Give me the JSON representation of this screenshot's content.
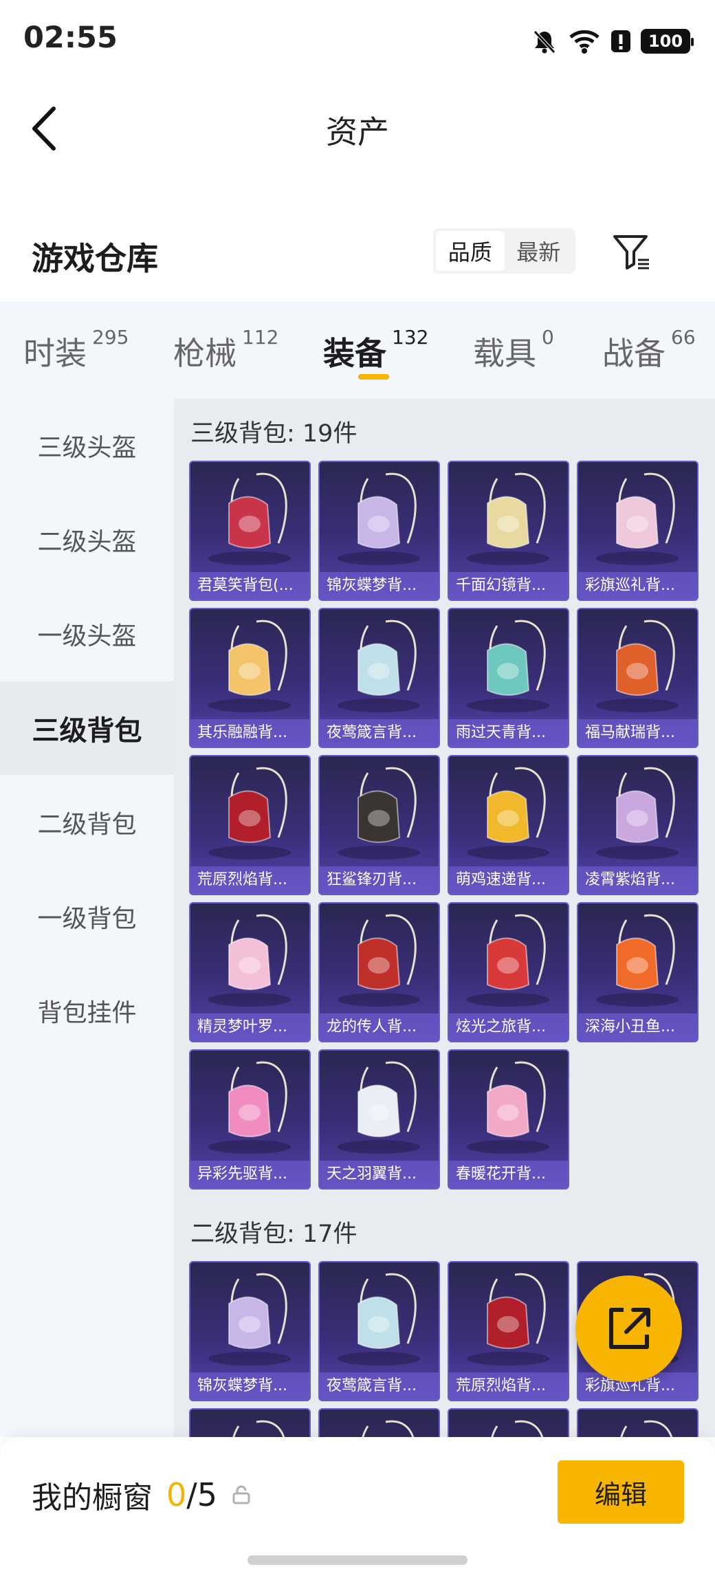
{
  "status": {
    "time": "02:55",
    "battery": "100"
  },
  "nav": {
    "title": "资产"
  },
  "warehouse": {
    "title": "游戏仓库",
    "sort": [
      "品质",
      "最新"
    ]
  },
  "tabs": [
    {
      "label": "时装",
      "count": "295"
    },
    {
      "label": "枪械",
      "count": "112"
    },
    {
      "label": "装备",
      "count": "132"
    },
    {
      "label": "载具",
      "count": "0"
    },
    {
      "label": "战备",
      "count": "66"
    }
  ],
  "sidebar": [
    "三级头盔",
    "二级头盔",
    "一级头盔",
    "三级背包",
    "二级背包",
    "一级背包",
    "背包挂件"
  ],
  "sections": [
    {
      "title": "三级背包: 19件",
      "items": [
        {
          "name": "君莫笑背包(...",
          "color": "#c8354a"
        },
        {
          "name": "锦灰蝶梦背...",
          "color": "#c9b6e8"
        },
        {
          "name": "千面幻镜背...",
          "color": "#e8d9a0"
        },
        {
          "name": "彩旗巡礼背...",
          "color": "#f0c8dc"
        },
        {
          "name": "其乐融融背...",
          "color": "#f3c46a"
        },
        {
          "name": "夜莺箴言背...",
          "color": "#bfe0e8"
        },
        {
          "name": "雨过天青背...",
          "color": "#6fc8c0"
        },
        {
          "name": "福马献瑞背...",
          "color": "#e0602c"
        },
        {
          "name": "荒原烈焰背...",
          "color": "#b01f2a"
        },
        {
          "name": "狂鲨锋刃背...",
          "color": "#3a3530"
        },
        {
          "name": "萌鸡速递背...",
          "color": "#f0b82a"
        },
        {
          "name": "凌霄紫焰背...",
          "color": "#c9a8e0"
        },
        {
          "name": "精灵梦叶罗...",
          "color": "#f4c0d8"
        },
        {
          "name": "龙的传人背...",
          "color": "#c0302a"
        },
        {
          "name": "炫光之旅背...",
          "color": "#d83a3a"
        },
        {
          "name": "深海小丑鱼...",
          "color": "#f06a2a"
        },
        {
          "name": "异彩先驱背...",
          "color": "#f08cc0"
        },
        {
          "name": "天之羽翼背...",
          "color": "#e8eef4"
        },
        {
          "name": "春暖花开背...",
          "color": "#f4a8c8"
        }
      ]
    },
    {
      "title": "二级背包: 17件",
      "items": [
        {
          "name": "锦灰蝶梦背...",
          "color": "#c9b6e8"
        },
        {
          "name": "夜莺箴言背...",
          "color": "#bfe0e8"
        },
        {
          "name": "荒原烈焰背...",
          "color": "#b01f2a"
        },
        {
          "name": "彩旗巡礼背...",
          "color": "#f0c8dc"
        },
        {
          "name": "",
          "color": "#c9b6e8"
        },
        {
          "name": "",
          "color": "#b01f2a"
        },
        {
          "name": "",
          "color": "#e0602c"
        },
        {
          "name": "",
          "color": "#c9a8e0"
        }
      ]
    }
  ],
  "showcase": {
    "label": "我的橱窗",
    "used": "0",
    "total": "/5",
    "edit": "编辑"
  }
}
